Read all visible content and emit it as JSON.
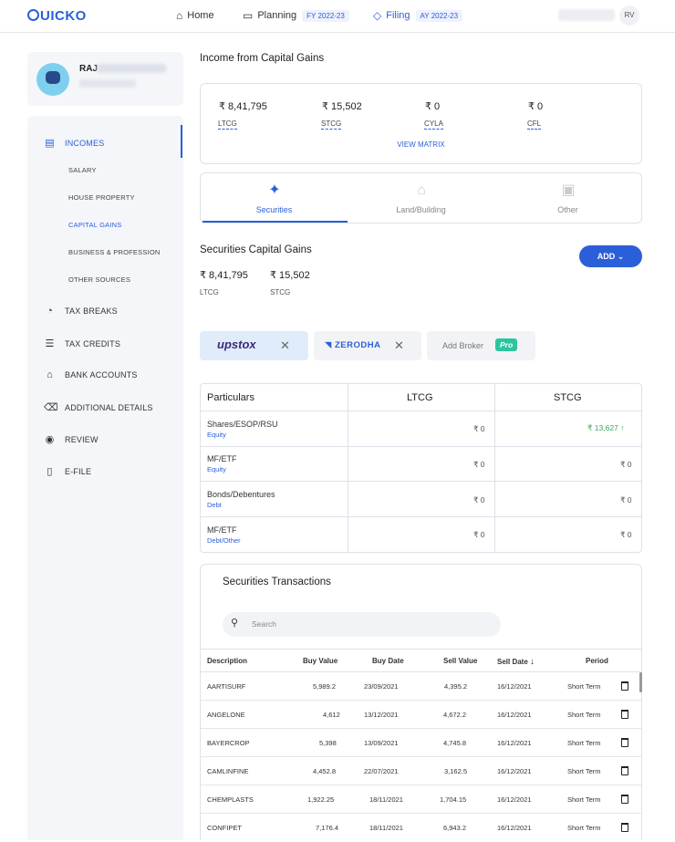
{
  "app": {
    "logo": "UICKO"
  },
  "topnav": {
    "home": "Home",
    "planning": "Planning",
    "planning_pill": "FY 2022-23",
    "filing": "Filing",
    "filing_pill": "AY 2022-23",
    "user_initials": "RV"
  },
  "profile": {
    "name": "RAJ"
  },
  "sidebar": {
    "incomes": "INCOMES",
    "sub": [
      "SALARY",
      "HOUSE PROPERTY",
      "CAPITAL GAINS",
      "BUSINESS & PROFESSION",
      "OTHER SOURCES"
    ],
    "items": [
      "TAX BREAKS",
      "TAX CREDITS",
      "BANK ACCOUNTS",
      "ADDITIONAL DETAILS",
      "REVIEW",
      "E-FILE"
    ]
  },
  "page_title": "Income from Capital Gains",
  "summary": {
    "items": [
      {
        "value": "₹ 8,41,795",
        "label": "LTCG"
      },
      {
        "value": "₹ 15,502",
        "label": "STCG"
      },
      {
        "value": "₹ 0",
        "label": "CYLA"
      },
      {
        "value": "₹ 0",
        "label": "CFL"
      }
    ],
    "view_matrix": "VIEW MATRIX"
  },
  "tabs": [
    "Securities",
    "Land/Building",
    "Other"
  ],
  "securities": {
    "title": "Securities Capital Gains",
    "add": "ADD",
    "ltcg_value": "₹ 8,41,795",
    "ltcg_label": "LTCG",
    "stcg_value": "₹ 15,502",
    "stcg_label": "STCG"
  },
  "brokers": {
    "upstox": "upstox",
    "zerodha": "ZERODHA",
    "add": "Add Broker",
    "pro": "Pro"
  },
  "particulars": {
    "headers": [
      "Particulars",
      "LTCG",
      "STCG"
    ],
    "rows": [
      {
        "name": "Shares/ESOP/RSU",
        "sub": "Equity",
        "ltcg": "₹ 0",
        "stcg": "₹ 13,627 ↑"
      },
      {
        "name": "MF/ETF",
        "sub": "Equity",
        "ltcg": "₹ 0",
        "stcg": "₹ 0"
      },
      {
        "name": "Bonds/Debentures",
        "sub": "Debt",
        "ltcg": "₹ 0",
        "stcg": "₹ 0"
      },
      {
        "name": "MF/ETF",
        "sub": "Debt/Other",
        "ltcg": "₹ 0",
        "stcg": "₹ 0"
      }
    ]
  },
  "transactions": {
    "title": "Securities Transactions",
    "search_placeholder": "Search",
    "headers": [
      "Description",
      "Buy Value",
      "Buy Date",
      "Sell Value",
      "Sell Date",
      "Period"
    ],
    "rows": [
      [
        "AARTISURF",
        "5,989.2",
        "23/09/2021",
        "4,395.2",
        "16/12/2021",
        "Short Term"
      ],
      [
        "ANGELONE",
        "4,612",
        "13/12/2021",
        "4,672.2",
        "16/12/2021",
        "Short Term"
      ],
      [
        "BAYERCROP",
        "5,398",
        "13/09/2021",
        "4,745.8",
        "16/12/2021",
        "Short Term"
      ],
      [
        "CAMLINFINE",
        "4,452.8",
        "22/07/2021",
        "3,162.5",
        "16/12/2021",
        "Short Term"
      ],
      [
        "CHEMPLASTS",
        "1,922.25",
        "18/11/2021",
        "1,704.15",
        "16/12/2021",
        "Short Term"
      ],
      [
        "CONFIPET",
        "7,176.4",
        "18/11/2021",
        "6,943.2",
        "16/12/2021",
        "Short Term"
      ]
    ]
  }
}
